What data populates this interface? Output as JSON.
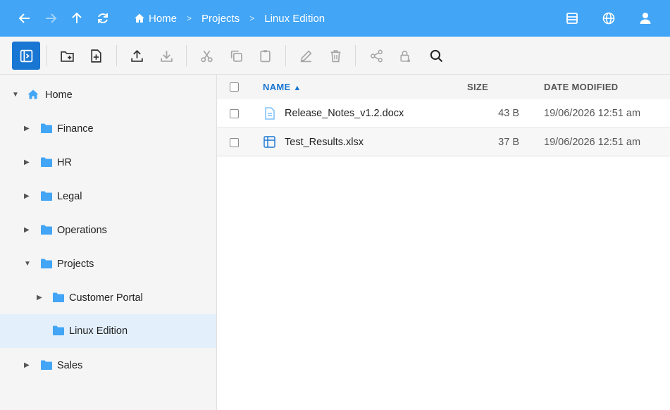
{
  "header": {
    "nav": {
      "back_icon": "arrow-left-icon",
      "forward_icon": "arrow-right-icon",
      "up_icon": "arrow-up-icon",
      "refresh_icon": "refresh-icon"
    },
    "breadcrumbs": [
      "Home",
      "Projects",
      "Linux Edition"
    ],
    "separator": ">",
    "right_icons": [
      "layout-icon",
      "globe-icon",
      "user-icon"
    ]
  },
  "toolbar": {
    "buttons": [
      "toggle-sidebar",
      "new-folder",
      "new-file",
      "upload",
      "download",
      "cut",
      "copy",
      "paste",
      "rename",
      "delete",
      "share",
      "permissions",
      "search"
    ],
    "accent": "#1976d2"
  },
  "tree": {
    "root": "Home",
    "items": [
      "Finance",
      "HR",
      "Legal",
      "Operations",
      "Projects",
      "Customer Portal",
      "Linux Edition",
      "Sales"
    ],
    "folder_color": "#42a5f5"
  },
  "table": {
    "columns": {
      "name": "NAME",
      "size": "SIZE",
      "date": "DATE MODIFIED"
    },
    "sort_indicator": "▲",
    "rows": [
      {
        "name": "Release_Notes_v1.2.docx",
        "size": "43 B",
        "date": "19/06/2026 12:51 am",
        "icon": "document-icon"
      },
      {
        "name": "Test_Results.xlsx",
        "size": "37 B",
        "date": "19/06/2026 12:51 am",
        "icon": "spreadsheet-icon"
      }
    ]
  },
  "colors": {
    "header_bg": "#42a5f5",
    "selected_bg": "#e3f0fc",
    "link": "#1976d2"
  }
}
